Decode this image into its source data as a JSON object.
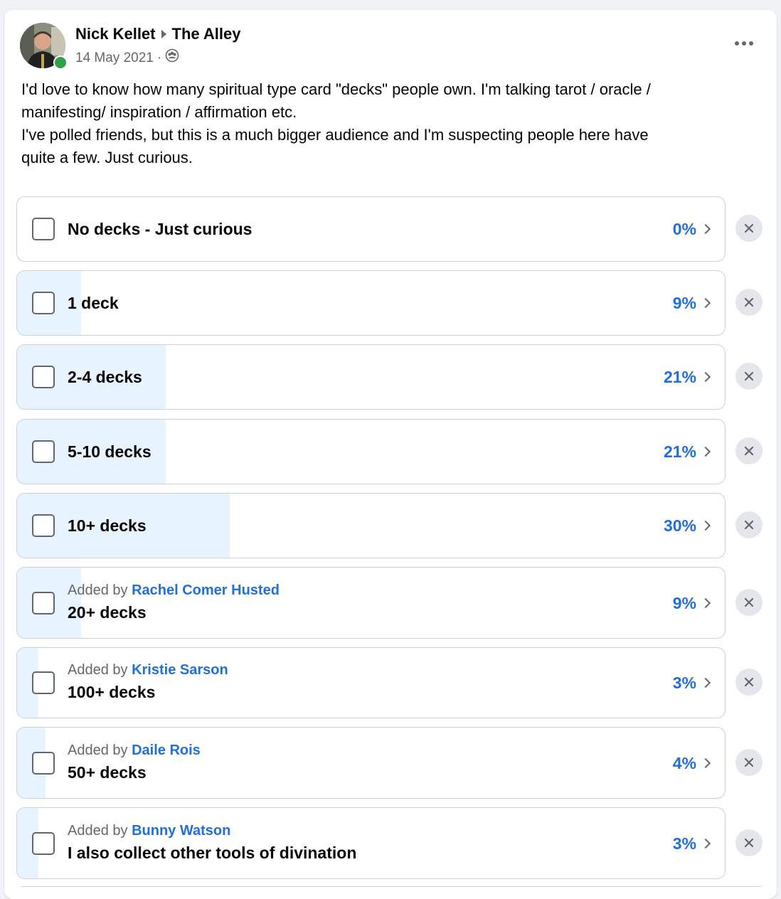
{
  "post": {
    "author": "Nick Kellet",
    "group": "The Alley",
    "date": "14 May 2021",
    "audience_icon": "group-audience-icon",
    "text_lines": [
      "I'd love to know how many spiritual type card \"decks\" people own. I'm talking tarot / oracle /",
      "manifesting/ inspiration / affirmation etc.",
      "I've polled friends, but this is a much bigger audience and I'm suspecting people here have",
      "quite a few. Just curious."
    ]
  },
  "poll": {
    "added_by_prefix": "Added by",
    "options": [
      {
        "label": "No decks - Just curious",
        "percent_text": "0%",
        "percent": 0,
        "added_by": null
      },
      {
        "label": "1 deck",
        "percent_text": "9%",
        "percent": 9,
        "added_by": null
      },
      {
        "label": "2-4 decks",
        "percent_text": "21%",
        "percent": 21,
        "added_by": null
      },
      {
        "label": "5-10 decks",
        "percent_text": "21%",
        "percent": 21,
        "added_by": null
      },
      {
        "label": "10+ decks",
        "percent_text": "30%",
        "percent": 30,
        "added_by": null
      },
      {
        "label": "20+ decks",
        "percent_text": "9%",
        "percent": 9,
        "added_by": "Rachel Comer Husted"
      },
      {
        "label": "100+ decks",
        "percent_text": "3%",
        "percent": 3,
        "added_by": "Kristie Sarson"
      },
      {
        "label": "50+ decks",
        "percent_text": "4%",
        "percent": 4,
        "added_by": "Daile Rois"
      },
      {
        "label": "I also collect other tools of divination",
        "percent_text": "3%",
        "percent": 3,
        "added_by": "Bunny Watson"
      }
    ]
  },
  "colors": {
    "accent": "#216fdb",
    "fill": "#e7f3ff",
    "online": "#31a24c"
  }
}
